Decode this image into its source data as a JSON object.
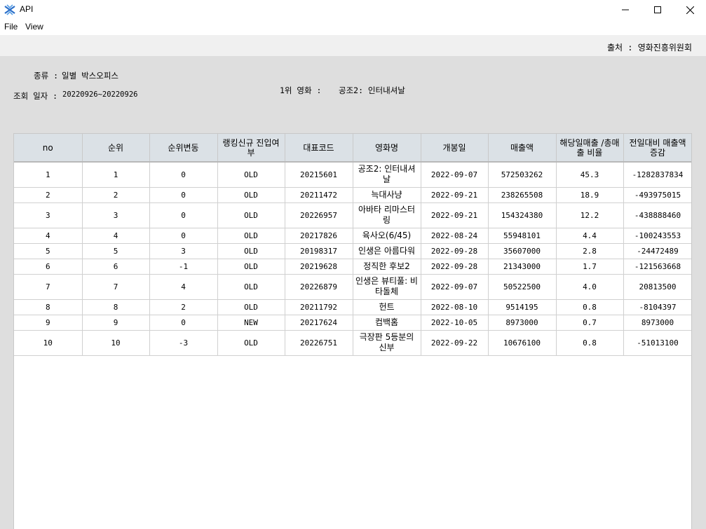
{
  "window": {
    "title": "API",
    "icon": "api-app-icon"
  },
  "menu": {
    "file": "File",
    "view": "View"
  },
  "source": "출처 : 영화진흥위원회",
  "info": {
    "type_label": "종류 :",
    "type_value": "일별 박스오피스",
    "date_label": "조회 일자 :",
    "date_value": "20220926~20220926",
    "top_label": "1위 영화 : ",
    "top_value": "공조2: 인터내셔날"
  },
  "table": {
    "headers": [
      "no",
      "순위",
      "순위변동",
      "랭킹신규 진입여부",
      "대표코드",
      "영화명",
      "개봉일",
      "매출액",
      "해당일매출 /총매출 비율",
      "전일대비 매출액 증감"
    ],
    "rows": [
      [
        "1",
        "1",
        "0",
        "OLD",
        "20215601",
        "공조2: 인터내셔날",
        "2022-09-07",
        "572503262",
        "45.3",
        "-1282837834"
      ],
      [
        "2",
        "2",
        "0",
        "OLD",
        "20211472",
        "늑대사냥",
        "2022-09-21",
        "238265508",
        "18.9",
        "-493975015"
      ],
      [
        "3",
        "3",
        "0",
        "OLD",
        "20226957",
        "아바타 리마스터링",
        "2022-09-21",
        "154324380",
        "12.2",
        "-438888460"
      ],
      [
        "4",
        "4",
        "0",
        "OLD",
        "20217826",
        "육사오(6/45)",
        "2022-08-24",
        "55948101",
        "4.4",
        "-100243553"
      ],
      [
        "5",
        "5",
        "3",
        "OLD",
        "20198317",
        "인생은 아름다워",
        "2022-09-28",
        "35607000",
        "2.8",
        "-24472489"
      ],
      [
        "6",
        "6",
        "-1",
        "OLD",
        "20219628",
        "정직한 후보2",
        "2022-09-28",
        "21343000",
        "1.7",
        "-121563668"
      ],
      [
        "7",
        "7",
        "4",
        "OLD",
        "20226879",
        "인생은 뷰티풀: 비타돌체",
        "2022-09-07",
        "50522500",
        "4.0",
        "20813500"
      ],
      [
        "8",
        "8",
        "2",
        "OLD",
        "20211792",
        "헌트",
        "2022-08-10",
        "9514195",
        "0.8",
        "-8104397"
      ],
      [
        "9",
        "9",
        "0",
        "NEW",
        "20217624",
        "컴백홈",
        "2022-10-05",
        "8973000",
        "0.7",
        "8973000"
      ],
      [
        "10",
        "10",
        "-3",
        "OLD",
        "20226751",
        "극장판 5등분의 신부",
        "2022-09-22",
        "10676100",
        "0.8",
        "-51013100"
      ]
    ],
    "tall_rows": [
      0,
      2,
      6,
      9
    ]
  }
}
